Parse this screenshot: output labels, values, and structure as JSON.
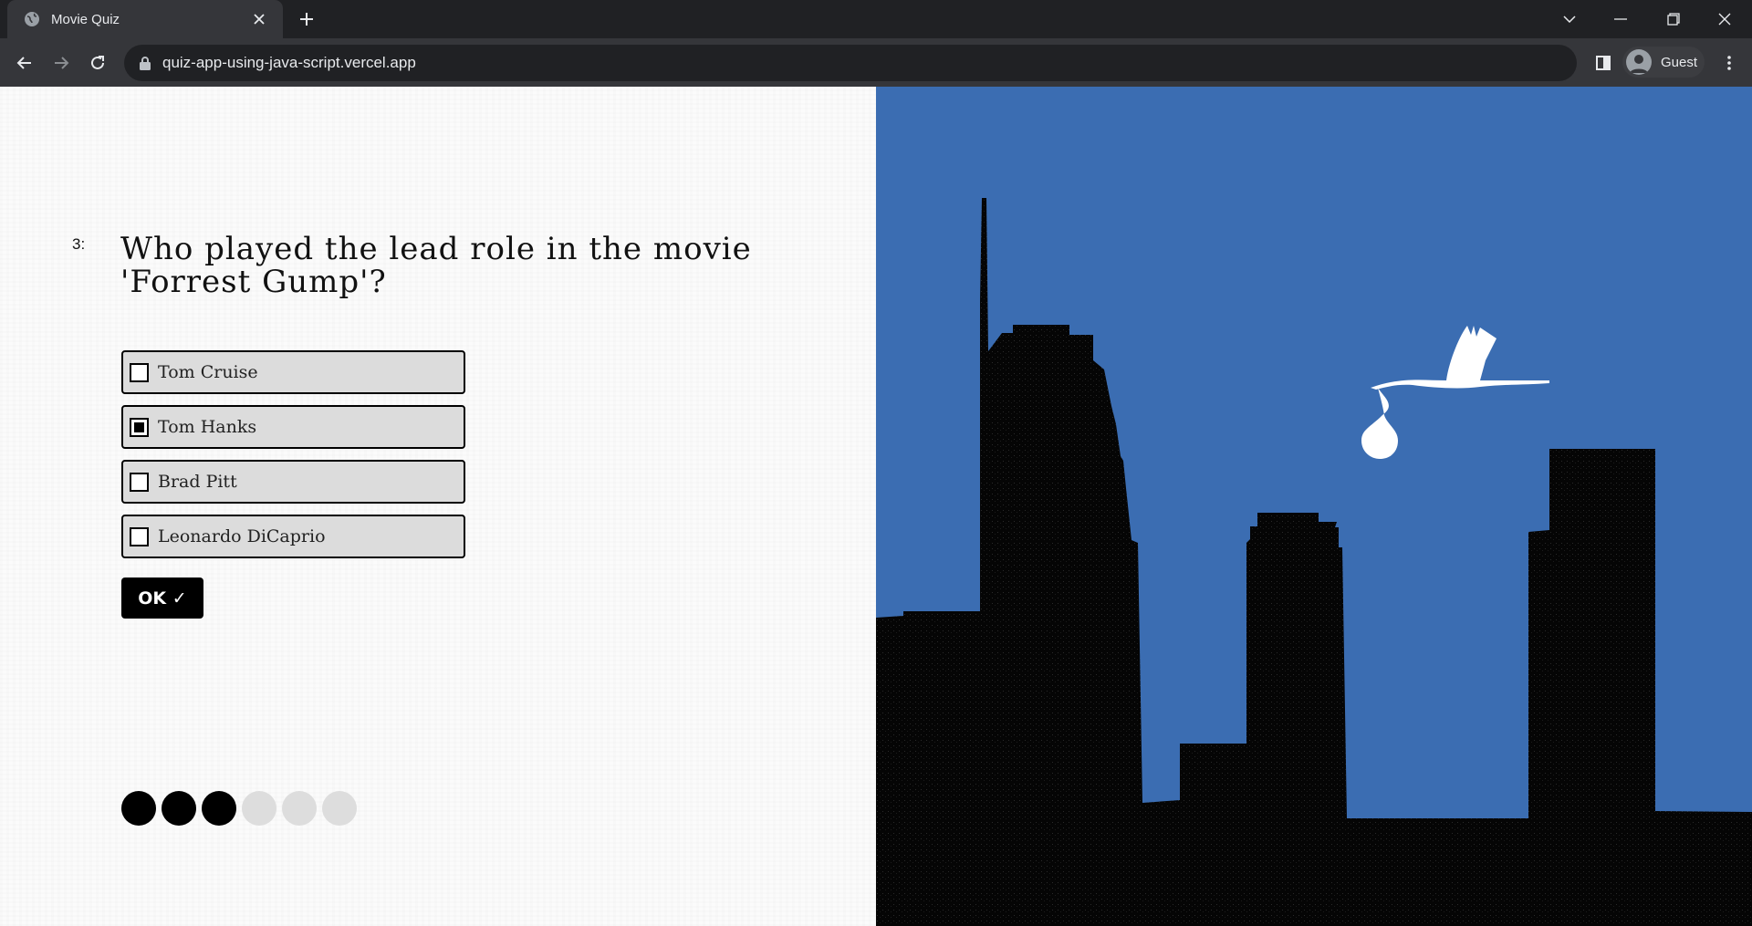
{
  "browser": {
    "tab_title": "Movie Quiz",
    "url": "quiz-app-using-java-script.vercel.app",
    "profile_label": "Guest"
  },
  "quiz": {
    "question_number": "3:",
    "question_text": "Who played the lead role in the movie 'Forrest Gump'?",
    "options": [
      {
        "label": "Tom Cruise",
        "checked": false
      },
      {
        "label": "Tom Hanks",
        "checked": true
      },
      {
        "label": "Brad Pitt",
        "checked": false
      },
      {
        "label": "Leonardo DiCaprio",
        "checked": false
      }
    ],
    "ok_label": "OK ✓",
    "progress": {
      "completed": 3,
      "total": 6
    }
  },
  "colors": {
    "sky": "#3b6db2",
    "skyline": "#050505",
    "stork": "#ffffff",
    "progress_done": "#000000",
    "progress_todo": "#dddddd"
  }
}
